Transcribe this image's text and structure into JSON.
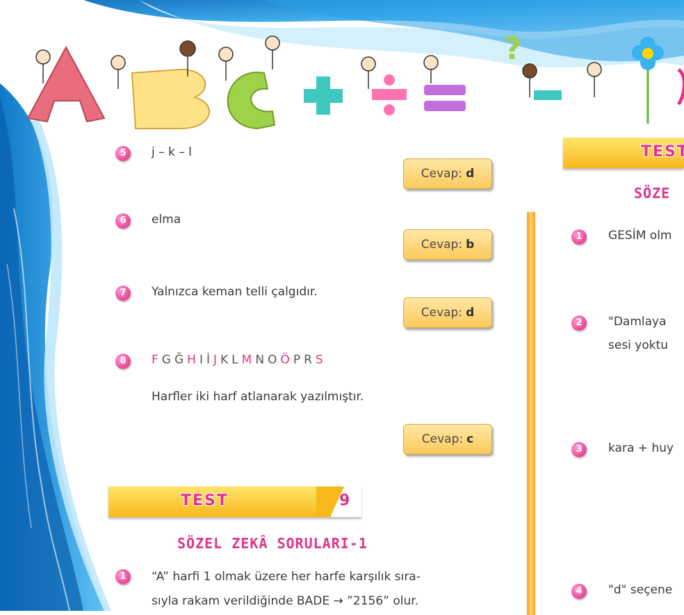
{
  "left_column": {
    "q5": {
      "number": "5",
      "text": "j – k – l",
      "answer_prefix": "Cevap:",
      "answer_letter": "d"
    },
    "q6": {
      "number": "6",
      "text": "elma",
      "answer_prefix": "Cevap:",
      "answer_letter": "b"
    },
    "q7": {
      "number": "7",
      "text": "Yalnızca keman telli çalgıdır.",
      "answer_prefix": "Cevap:",
      "answer_letter": "d"
    },
    "q8": {
      "number": "8",
      "letters": [
        {
          "ch": "F",
          "highlight": true
        },
        {
          "ch": "G",
          "highlight": false
        },
        {
          "ch": "Ğ",
          "highlight": false
        },
        {
          "ch": "H",
          "highlight": true
        },
        {
          "ch": "I",
          "highlight": false
        },
        {
          "ch": "İ",
          "highlight": false
        },
        {
          "ch": "J",
          "highlight": true
        },
        {
          "ch": "K",
          "highlight": false
        },
        {
          "ch": "L",
          "highlight": false
        },
        {
          "ch": "M",
          "highlight": true
        },
        {
          "ch": "N",
          "highlight": false
        },
        {
          "ch": "O",
          "highlight": false
        },
        {
          "ch": "Ö",
          "highlight": true
        },
        {
          "ch": "P",
          "highlight": false
        },
        {
          "ch": "R",
          "highlight": false
        },
        {
          "ch": "S",
          "highlight": true
        }
      ],
      "explanation": "Harfler iki harf atlanarak yazılmıştır.",
      "answer_prefix": "Cevap:",
      "answer_letter": "c"
    },
    "test": {
      "label": "TEST",
      "number": "9"
    },
    "section_title": "SÖZEL ZEKÂ SORULARI-1",
    "q1": {
      "number": "1",
      "line1": "“A” harfi 1 olmak üzere her harfe karşılık sıra-",
      "line2": "sıyla rakam verildiğinde BADE → ”2156” olur."
    }
  },
  "right_column": {
    "test": {
      "label": "TEST"
    },
    "section_title": "SÖZE",
    "q1": {
      "number": "1",
      "text": "GESİM olm"
    },
    "q2": {
      "number": "2",
      "line1": "\"Damlaya",
      "line2": "sesi yoktu"
    },
    "q3": {
      "number": "3",
      "text": "kara + huy"
    },
    "q4": {
      "number": "4",
      "text": "\"d\" seçene"
    }
  },
  "colors": {
    "accent_pink": "#e0338a",
    "answer_box": "#fcca5d",
    "test_bar": "#f7b81c",
    "bg_blue": "#1e90d6"
  }
}
